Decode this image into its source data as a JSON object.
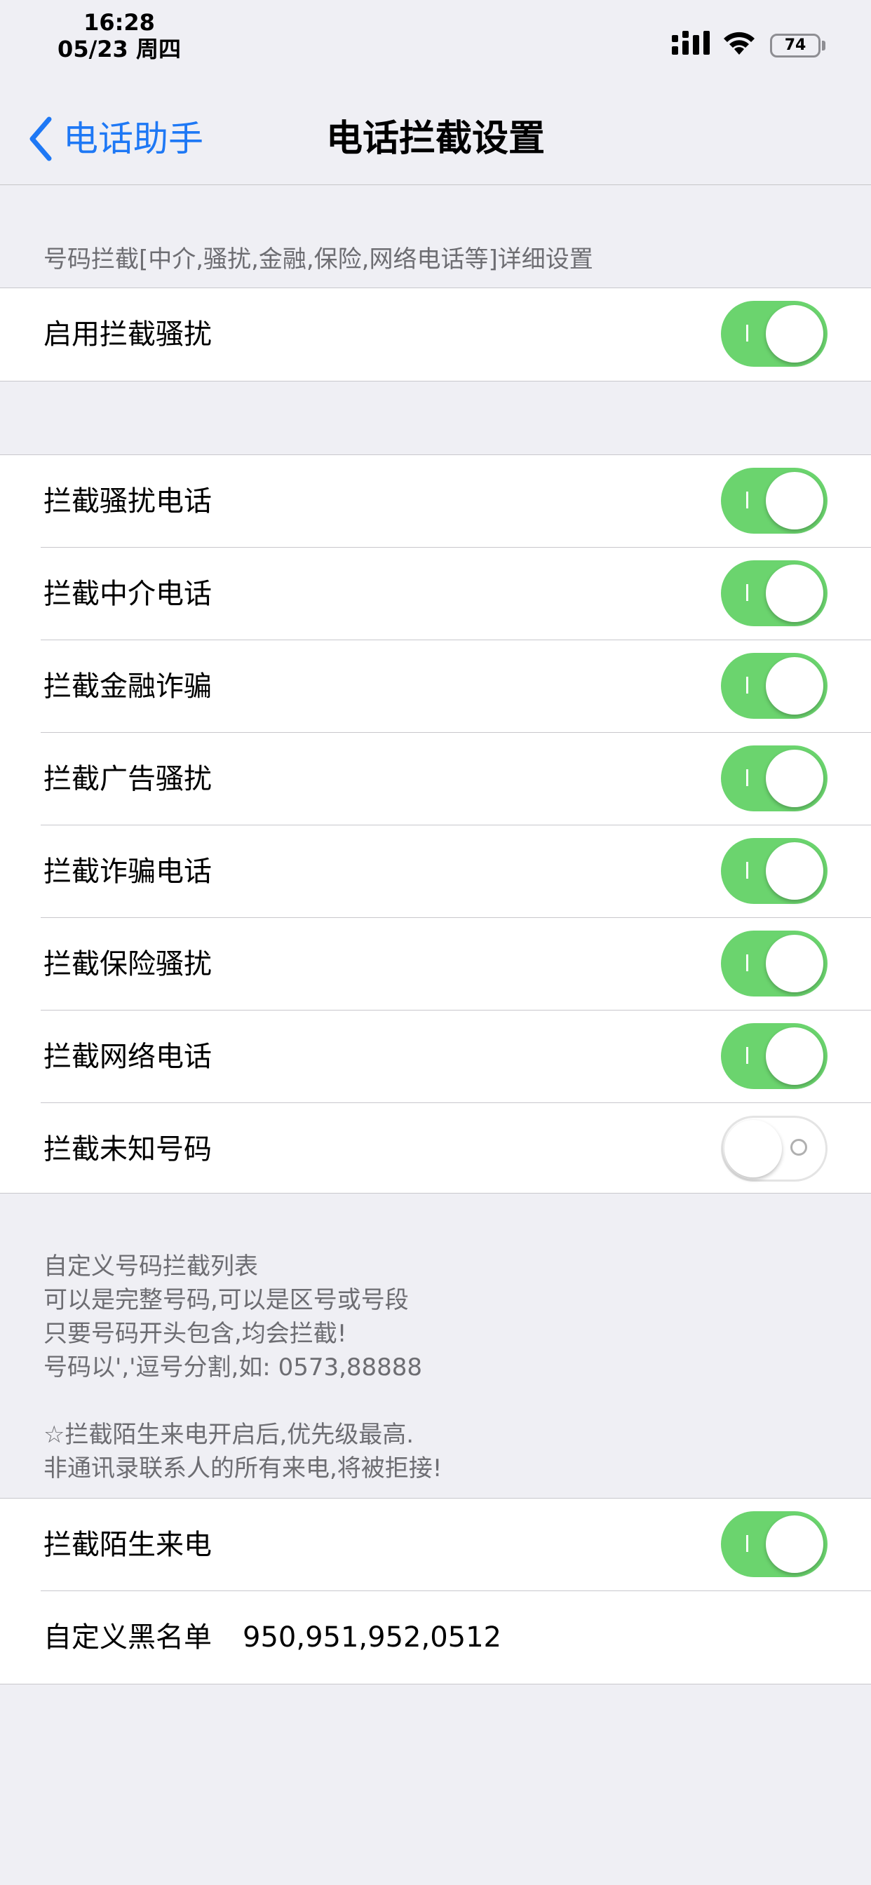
{
  "status_bar": {
    "time": "16:28",
    "date": "05/23 周四",
    "battery": "74"
  },
  "nav": {
    "back_label": "电话助手",
    "title": "电话拦截设置"
  },
  "section1": {
    "header": "号码拦截[中介,骚扰,金融,保险,网络电话等]详细设置",
    "rows": [
      {
        "label": "启用拦截骚扰",
        "on": true
      }
    ]
  },
  "section2": {
    "rows": [
      {
        "label": "拦截骚扰电话",
        "on": true
      },
      {
        "label": "拦截中介电话",
        "on": true
      },
      {
        "label": "拦截金融诈骗",
        "on": true
      },
      {
        "label": "拦截广告骚扰",
        "on": true
      },
      {
        "label": "拦截诈骗电话",
        "on": true
      },
      {
        "label": "拦截保险骚扰",
        "on": true
      },
      {
        "label": "拦截网络电话",
        "on": true
      },
      {
        "label": "拦截未知号码",
        "on": false
      }
    ]
  },
  "notes": {
    "lines": [
      "自定义号码拦截列表",
      "可以是完整号码,可以是区号或号段",
      "只要号码开头包含,均会拦截!",
      "号码以','逗号分割,如: 0573,88888",
      "",
      "☆拦截陌生来电开启后,优先级最高.",
      "非通讯录联系人的所有来电,将被拒接!"
    ]
  },
  "section3": {
    "stranger": {
      "label": "拦截陌生来电",
      "on": true
    },
    "blacklist": {
      "label": "自定义黑名单",
      "value": "950,951,952,0512"
    }
  },
  "colors": {
    "accent": "#1e78f5",
    "toggle_on": "#6bd46e",
    "background": "#efeff4"
  }
}
